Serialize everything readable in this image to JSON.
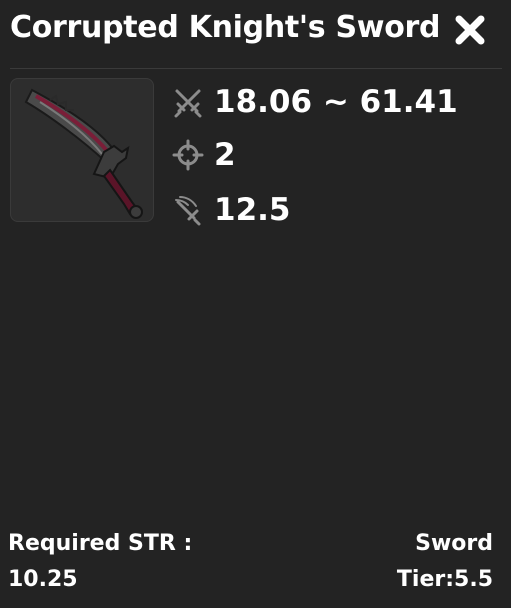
{
  "item": {
    "name": "Corrupted Knight's Sword",
    "image_icon": "corrupted-sword-icon"
  },
  "stats": {
    "damage": {
      "icon": "crossed-swords-icon",
      "value": "18.06 ~ 61.41"
    },
    "accuracy": {
      "icon": "crosshair-icon",
      "value": "2"
    },
    "speed": {
      "icon": "swinging-sword-icon",
      "value": "12.5"
    }
  },
  "requirement": {
    "label": "Required STR :",
    "value": "10.25"
  },
  "type": "Sword",
  "tier": "Tier:5.5",
  "close_icon": "close-icon",
  "colors": {
    "panel": "#232323",
    "frame": "#2d2d2d",
    "text": "#ffffff",
    "icon": "#8c8c8c",
    "blade_accent": "#7a1e38"
  }
}
